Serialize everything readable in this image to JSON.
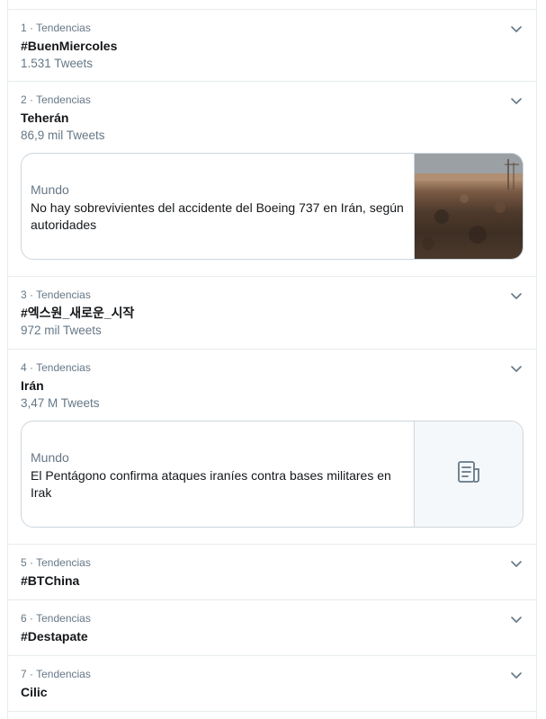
{
  "trends": [
    {
      "meta": "1 · Tendencias",
      "name": "#BuenMiercoles",
      "count": "1.531 Tweets"
    },
    {
      "meta": "2 · Tendencias",
      "name": "Teherán",
      "count": "86,9 mil Tweets",
      "card": {
        "category": "Mundo",
        "title": "No hay sobrevivientes del accidente del Boeing 737 en Irán, según autoridades",
        "media": "photo"
      }
    },
    {
      "meta": "3 · Tendencias",
      "name": "#엑스원_새로운_시작",
      "count": "972 mil Tweets"
    },
    {
      "meta": "4 · Tendencias",
      "name": "Irán",
      "count": "3,47 M Tweets",
      "card": {
        "category": "Mundo",
        "title": "El Pentágono confirma ataques iraníes contra bases militares en Irak",
        "media": "article-icon"
      }
    },
    {
      "meta": "5 · Tendencias",
      "name": "#BTChina"
    },
    {
      "meta": "6 · Tendencias",
      "name": "#Destapate"
    },
    {
      "meta": "7 · Tendencias",
      "name": "Cilic"
    }
  ],
  "colors": {
    "border": "#e6ecf0",
    "secondary_text": "#657786",
    "primary_text": "#14171a",
    "card_border": "#ccd6dd"
  }
}
